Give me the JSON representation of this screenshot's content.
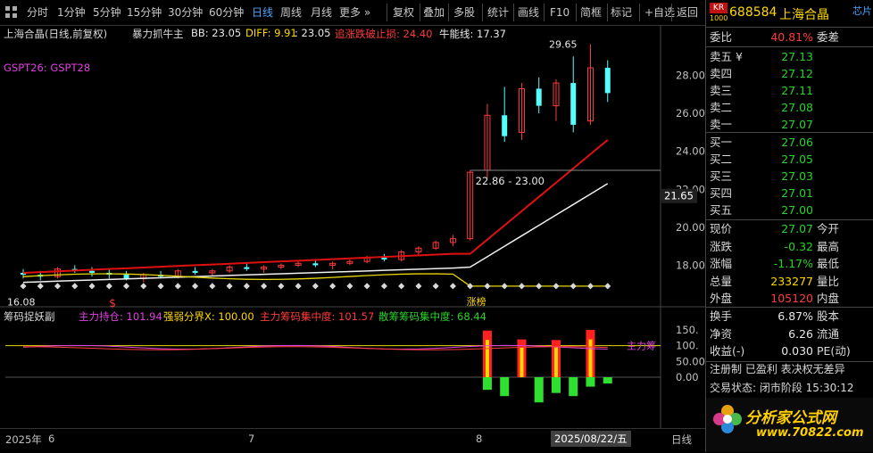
{
  "toolbar": {
    "items": [
      "分时",
      "1分钟",
      "5分钟",
      "15分钟",
      "30分钟",
      "60分钟",
      "日线",
      "周线",
      "月线",
      "更多 »",
      "复权",
      "叠加",
      "多股",
      "统计",
      "画线",
      "F10",
      "简框",
      "标记",
      "+自选",
      "返回"
    ],
    "active_index": 6
  },
  "main_legend": {
    "stock": "上海合晶(日线,前复权)",
    "indicator": "暴力抓牛主",
    "bb": "BB: 23.05",
    "diff": "DIFF: 9.91",
    "diff_tail": ": 23.05",
    "stop": "追涨跌破止损: 24.40",
    "bull": "牛能线: 17.37",
    "gspt": "GSPT26:  GSPT28"
  },
  "price_axis": {
    "ticks": [
      "28.00",
      "26.00",
      "24.00",
      "22.00",
      "20.00",
      "18.00"
    ],
    "current_price_tag": "21.65"
  },
  "annotations": {
    "high_label": "29.65",
    "low_label": "16.08",
    "range_label": "22.86 - 23.00",
    "zt_label": "涨榜",
    "dollar": "$"
  },
  "sub_legend": {
    "name": "筹码捉妖副",
    "main_hold": "主力持仓: 101.94",
    "strong_weak": "强弱分界X: 100.00",
    "main_conc": "主力筹码集中度: 101.57",
    "retail_conc": "散筹筹码集中度: 68.44",
    "right_tag": "主力筹"
  },
  "sub_axis": {
    "ticks": [
      "150.",
      "100.",
      "50.00",
      "0.00"
    ]
  },
  "time_axis": {
    "labels": [
      "2025年",
      "6",
      "7",
      "8",
      "2025/08/22/五"
    ],
    "right": "日线"
  },
  "panel": {
    "code_badge_top": "KR",
    "code_badge_bot": "1000",
    "code": "688584",
    "name": "上海合晶",
    "extra": "芯片",
    "webi_label": "委比",
    "webi_val": "40.81%",
    "weicha_label": "委差",
    "asks": [
      {
        "label": "卖五 ¥",
        "price": "27.13"
      },
      {
        "label": "卖四",
        "price": "27.12"
      },
      {
        "label": "卖三",
        "price": "27.11"
      },
      {
        "label": "卖二",
        "price": "27.08"
      },
      {
        "label": "卖一",
        "price": "27.07"
      }
    ],
    "bids": [
      {
        "label": "买一",
        "price": "27.06"
      },
      {
        "label": "买二",
        "price": "27.05"
      },
      {
        "label": "买三",
        "price": "27.03"
      },
      {
        "label": "买四",
        "price": "27.01"
      },
      {
        "label": "买五",
        "price": "27.00"
      }
    ],
    "quote": [
      {
        "l": "现价",
        "v": "27.07",
        "r": "今开",
        "c": "green"
      },
      {
        "l": "涨跌",
        "v": "-0.32",
        "r": "最高",
        "c": "green"
      },
      {
        "l": "涨幅",
        "v": "-1.17%",
        "r": "最低",
        "c": "green"
      },
      {
        "l": "总量",
        "v": "233277",
        "r": "量比",
        "c": "yellow"
      },
      {
        "l": "外盘",
        "v": "105120",
        "r": "内盘",
        "c": "red"
      }
    ],
    "stats": [
      {
        "l": "换手",
        "v": "6.87%",
        "r": "股本"
      },
      {
        "l": "净资",
        "v": "6.26",
        "r": "流通"
      },
      {
        "l": "收益(-)",
        "v": "0.030",
        "r": "PE(动)"
      }
    ],
    "reg": "注册制 已盈利 表决权无差异",
    "status": "交易状态: 闭市阶段 15:30:12",
    "brand": "分析家公式网",
    "brand_url": "www.70822.com"
  },
  "chart_data": {
    "type": "candlestick",
    "ylim": [
      16.0,
      30.0
    ],
    "note_series": [
      "暴力抓牛主",
      "牛能线"
    ],
    "candles": [
      [
        17.6,
        17.8,
        17.3,
        17.5
      ],
      [
        17.5,
        17.7,
        17.2,
        17.4
      ],
      [
        17.4,
        17.9,
        17.3,
        17.8
      ],
      [
        17.8,
        18.0,
        17.6,
        17.7
      ],
      [
        17.7,
        17.9,
        17.4,
        17.6
      ],
      [
        17.6,
        17.8,
        17.3,
        17.5
      ],
      [
        17.5,
        17.7,
        17.2,
        17.3
      ],
      [
        17.3,
        17.6,
        17.1,
        17.5
      ],
      [
        17.5,
        17.7,
        17.3,
        17.4
      ],
      [
        17.4,
        17.8,
        17.3,
        17.7
      ],
      [
        17.7,
        17.9,
        17.5,
        17.6
      ],
      [
        17.6,
        17.8,
        17.4,
        17.7
      ],
      [
        17.7,
        18.0,
        17.6,
        17.9
      ],
      [
        17.9,
        18.1,
        17.7,
        17.8
      ],
      [
        17.8,
        18.0,
        17.6,
        17.9
      ],
      [
        17.9,
        18.1,
        17.8,
        18.0
      ],
      [
        18.0,
        18.2,
        17.9,
        18.1
      ],
      [
        18.1,
        18.3,
        17.9,
        18.0
      ],
      [
        18.0,
        18.2,
        17.8,
        18.1
      ],
      [
        18.1,
        18.3,
        18.0,
        18.2
      ],
      [
        18.2,
        18.5,
        18.1,
        18.4
      ],
      [
        18.4,
        18.6,
        18.2,
        18.3
      ],
      [
        18.3,
        18.8,
        18.2,
        18.7
      ],
      [
        18.7,
        19.0,
        18.5,
        18.9
      ],
      [
        18.9,
        19.3,
        18.8,
        19.2
      ],
      [
        19.2,
        19.6,
        19.0,
        19.4
      ],
      [
        19.4,
        23.0,
        19.3,
        22.9
      ],
      [
        23.0,
        26.5,
        22.6,
        25.9
      ],
      [
        25.9,
        27.4,
        24.5,
        24.8
      ],
      [
        25.0,
        27.6,
        24.6,
        27.3
      ],
      [
        27.3,
        27.9,
        26.0,
        26.4
      ],
      [
        26.4,
        27.8,
        25.6,
        27.6
      ],
      [
        27.6,
        29.0,
        25.0,
        25.4
      ],
      [
        25.6,
        29.65,
        25.4,
        28.4
      ],
      [
        28.4,
        28.8,
        26.6,
        27.07
      ]
    ],
    "sub": {
      "red_bars": [
        0,
        0,
        0,
        0,
        0,
        0,
        0,
        0,
        0,
        0,
        0,
        0,
        0,
        0,
        0,
        0,
        0,
        0,
        0,
        0,
        0,
        0,
        0,
        0,
        0,
        0,
        0,
        148,
        0,
        120,
        0,
        118,
        0,
        150,
        0
      ],
      "green_bars": [
        0,
        0,
        0,
        0,
        0,
        0,
        0,
        0,
        0,
        0,
        0,
        0,
        0,
        0,
        0,
        0,
        0,
        0,
        0,
        0,
        0,
        0,
        0,
        0,
        0,
        0,
        0,
        -40,
        -60,
        0,
        -80,
        -50,
        -60,
        -30,
        -20
      ]
    }
  }
}
